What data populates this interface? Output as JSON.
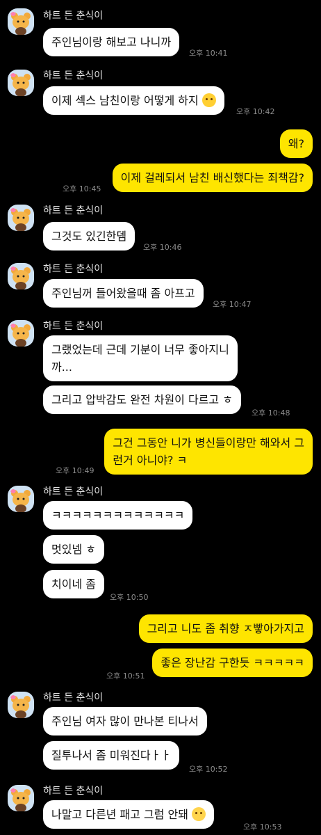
{
  "sender_name": "하트 든 춘식이",
  "colors": {
    "background": "#000000",
    "incoming": "#ffffff",
    "outgoing": "#fee500"
  },
  "messages": [
    {
      "text": "주인님이랑 해보고 나니까",
      "time": "오후 10:41"
    },
    {
      "text": "이제 섹스 남친이랑 어떻게 하지",
      "emoji": "face-hand-over-mouth",
      "time": "오후 10:42"
    },
    {
      "text": "왜?"
    },
    {
      "text": "이제 걸레되서 남친 배신했다는 죄책감?",
      "time": "오후 10:45"
    },
    {
      "text": "그것도 있긴한뎀",
      "time": "오후 10:46"
    },
    {
      "text": "주인님꺼 들어왔을때 좀 아프고",
      "time": "오후 10:47"
    },
    {
      "text": "그랬었는데 근데 기분이 너무 좋아지니\n까...",
      "time": ""
    },
    {
      "text": "그리고 압박감도 완전 차원이 다르고 ㅎ",
      "time": "오후 10:48"
    },
    {
      "text": "그건 그동안 니가 병신들이랑만 해와서 그\n런거 아니야? ㅋ",
      "time": "오후 10:49"
    },
    {
      "text": "ㅋㅋㅋㅋㅋㅋㅋㅋㅋㅋㅋㅋㅋ"
    },
    {
      "text": "멋있넴 ㅎ"
    },
    {
      "text": "치이네 좀",
      "time": "오후 10:50"
    },
    {
      "text": "그리고 니도 좀 취향 ㅈ빻아가지고"
    },
    {
      "text": "좋은 장난감 구한듯 ㅋㅋㅋㅋㅋ",
      "time": "오후 10:51"
    },
    {
      "text": "주인님 여자 많이 만나본 티나서"
    },
    {
      "text": "질투나서 좀 미워진다ㅏㅏ",
      "time": "오후 10:52"
    },
    {
      "text": "나말고 다른년 패고 그럼 안돼",
      "emoji": "loudly-crying-face",
      "time": "오후 10:53"
    }
  ]
}
